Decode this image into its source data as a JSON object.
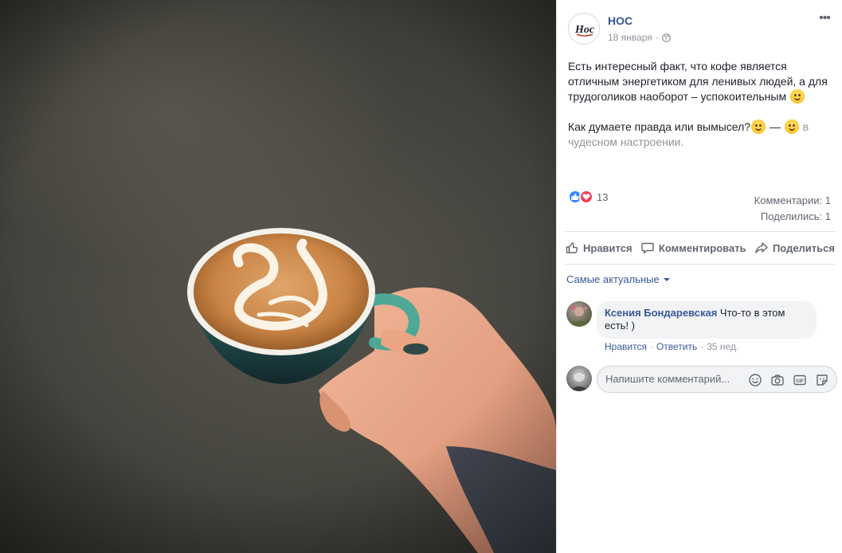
{
  "post": {
    "page_name": "НОС",
    "logo_text": "Нос",
    "date": "18 января",
    "separator": "·",
    "more": "•••",
    "text_p1": "Есть интересный факт, что кофе является отличным энергетиком для ленивых людей, а для трудоголиков наоборот – успокоительным",
    "text_p2": "Как думаете правда или вымысел?",
    "dash": " — ",
    "feeling": " в чудесном настроении."
  },
  "reactions": {
    "count": "13",
    "comments": "Комментарии: 1",
    "shares": "Поделились: 1"
  },
  "actions": {
    "like": "Нравится",
    "comment": "Комментировать",
    "share": "Поделиться"
  },
  "sort": {
    "label": "Самые актуальные"
  },
  "comment": {
    "author": "Ксения Бондаревская",
    "text": "Что-то в этом есть! )",
    "like": "Нравится",
    "reply": "Ответить",
    "sep": "·",
    "time": "35 нед."
  },
  "composer": {
    "placeholder": "Напишите комментарий..."
  },
  "icons": {
    "globe": "globe-icon",
    "like": "thumbs-up-icon",
    "comment": "speech-bubble-icon",
    "share": "share-arrow-icon",
    "emoji": "smiley-icon",
    "camera": "camera-icon",
    "gif": "gif-icon",
    "sticker": "sticker-icon"
  },
  "colors": {
    "link": "#385898",
    "like_reaction": "#2d88ff",
    "love_reaction": "#f33e58",
    "cup": "#4fa896"
  }
}
